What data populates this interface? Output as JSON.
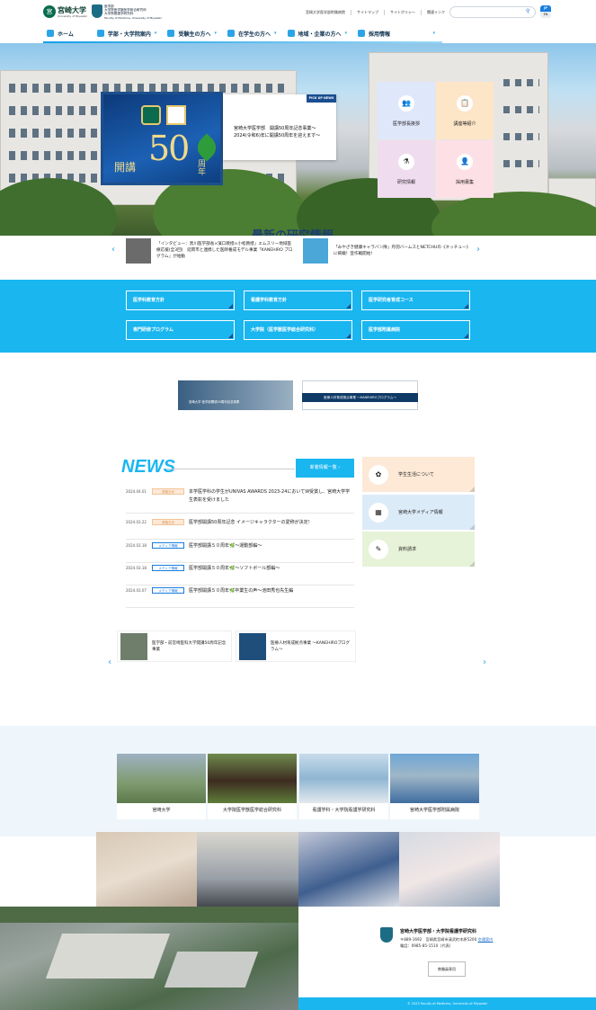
{
  "header": {
    "logo_text": "宮崎大学",
    "logo_sub": "University of Miyazaki",
    "faculty_lines": [
      "医学部",
      "大学院医学獣医学総合研究科",
      "大学院看護学研究科",
      "Faculty of Medicine, University of Miyazaki"
    ],
    "top_links": [
      "宮崎大学医学部附属病院",
      "サイトマップ",
      "サイトポリシー",
      "関連リンク"
    ],
    "search_placeholder": "",
    "lang_jp": "JP",
    "lang_en": "EN"
  },
  "nav": {
    "items": [
      "ホーム",
      "学部・大学院案内",
      "受験生の方へ",
      "在学生の方へ",
      "地域・企業の方へ",
      "採用情報"
    ]
  },
  "hero": {
    "anniv_number": "50",
    "anniv_left": "開講",
    "anniv_right": "周年",
    "pickup_tag": "PICK UP NEWS",
    "pickup_text": "宮崎大学医学部　開講50周年記念事業～2024(令和6)年に開講50周年を迎えます～",
    "tiles": [
      {
        "label": "医学部長挨拶",
        "icon": "person-icon",
        "glyph": "👥",
        "color": "#dfe7fb"
      },
      {
        "label": "講座等紹介",
        "icon": "board-icon",
        "glyph": "📋",
        "color": "#fde5c8"
      },
      {
        "label": "研究情報",
        "icon": "flask-icon",
        "glyph": "⚗",
        "color": "#f0dcef"
      },
      {
        "label": "採用募集",
        "icon": "people-icon",
        "glyph": "👤",
        "color": "#fde0e6"
      }
    ],
    "research_title": "最新の研究情報"
  },
  "research_slider": {
    "cards": [
      {
        "text": "「インタビュー：黒川医学部長×濱口教授×小松教授」エムスリー地域医療応援(全3回)　延岡市と連携した医師養成モデル事業「KANEHIRO プログラム」が始動"
      },
      {
        "text": "「みやざき健康キャラバン隊」丹羽バームスとNETCHUの《ネッチュー》に掲載！宣作戦開始！"
      }
    ]
  },
  "band_links": [
    "医学科教育方針",
    "看護学科教育方針",
    "医学研究者育成コース",
    "専門研修プログラム",
    "大学院（医学獣医学総合研究科）",
    "医学部附属病院"
  ],
  "banners": {
    "b1_text": "宮崎大学 医学部開講50周年記念事業",
    "b2_text": "医療人材育成拠点事業 ～KANEHIROプログラム～"
  },
  "news": {
    "heading": "NEWS",
    "more_label": "新着情報一覧 ›",
    "items": [
      {
        "date": "2024.04.01",
        "tag": "お知らせ",
        "type": "notice",
        "title": "本学医学科の学生がUNIVAS AWARDS 2023-24においてW受賞し、宮崎大学学生表彰を受けました"
      },
      {
        "date": "2024.03.22",
        "tag": "お知らせ",
        "type": "notice",
        "title": "医学部開講50周年記念 イメージキャラクターの愛称が決定！"
      },
      {
        "date": "2024.03.18",
        "tag": "メディア情報",
        "type": "media",
        "title": "医学部開講５０周年🌿～運動部編～"
      },
      {
        "date": "2024.03.18",
        "tag": "メディア情報",
        "type": "media",
        "title": "医学部開講５０周年🌿～ソフトボール部編～"
      },
      {
        "date": "2024.03.07",
        "tag": "メディア情報",
        "type": "media",
        "title": "医学部開講５０周年🌿卒業生の声～池田秀也先生編"
      }
    ],
    "side": [
      {
        "label": "学生生活について",
        "icon": "student-life-icon",
        "glyph": "✿",
        "color": "#fde9d6"
      },
      {
        "label": "宮崎大学メディア情報",
        "icon": "media-icon",
        "glyph": "▦",
        "color": "#dcebf8"
      },
      {
        "label": "資料請求",
        "icon": "document-icon",
        "glyph": "✎",
        "color": "#e6f3d8"
      }
    ]
  },
  "small_slider": [
    {
      "text": "医学部・前宮崎医科大学開講50周年記念事業"
    },
    {
      "text": "医療人材育成拠点事業 ～KANEHIROプログラム～"
    }
  ],
  "institutions": [
    "宮崎大学",
    "大学院医学獣医学総合研究科",
    "看護学科・大学院看護学研究科",
    "宮崎大学医学部附属病院"
  ],
  "footer": {
    "name": "宮崎大学医学部・大学院看護学研究科",
    "address": "〒889-1692　宮崎県宮崎市清武町木原5200",
    "access": "交通案内",
    "tel": "電話：0985-85-1510（代表）",
    "button": "教職員専用",
    "copyright": "© 2023 Faculty of Medicine, University of Miyazaki"
  }
}
